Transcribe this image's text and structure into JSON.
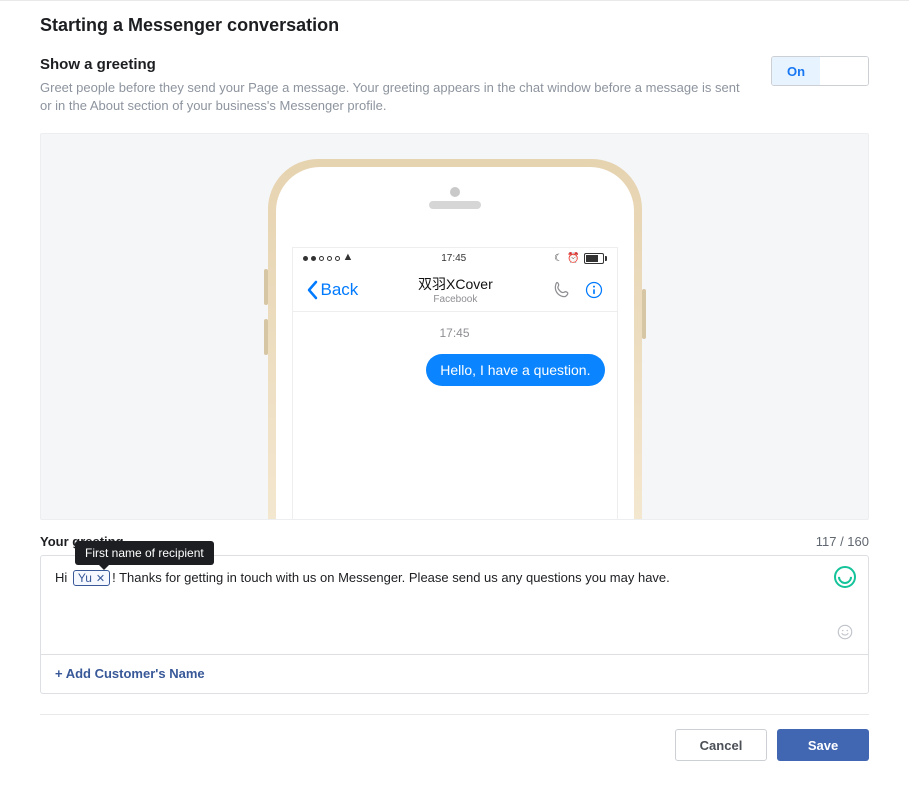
{
  "page_title": "Starting a Messenger conversation",
  "greeting_section": {
    "title": "Show a greeting",
    "description": "Greet people before they send your Page a message. Your greeting appears in the chat window before a message is sent or in the About section of your business's Messenger profile.",
    "toggle_on_label": "On",
    "toggle_state": "on"
  },
  "preview": {
    "status_time": "17:45",
    "nav_back": "Back",
    "nav_title": "双羽XCover",
    "nav_subtitle": "Facebook",
    "chat_time": "17:45",
    "bubble": "Hello, I have a question."
  },
  "editor": {
    "label": "Your greeting",
    "count": "117 / 160",
    "prefix": "Hi ",
    "token_value": "Yu",
    "token_tooltip": "First name of recipient",
    "suffix": "! Thanks for getting in touch with us on Messenger. Please send us any questions you may have.",
    "add_name": "+ Add Customer's Name"
  },
  "actions": {
    "cancel": "Cancel",
    "save": "Save"
  }
}
